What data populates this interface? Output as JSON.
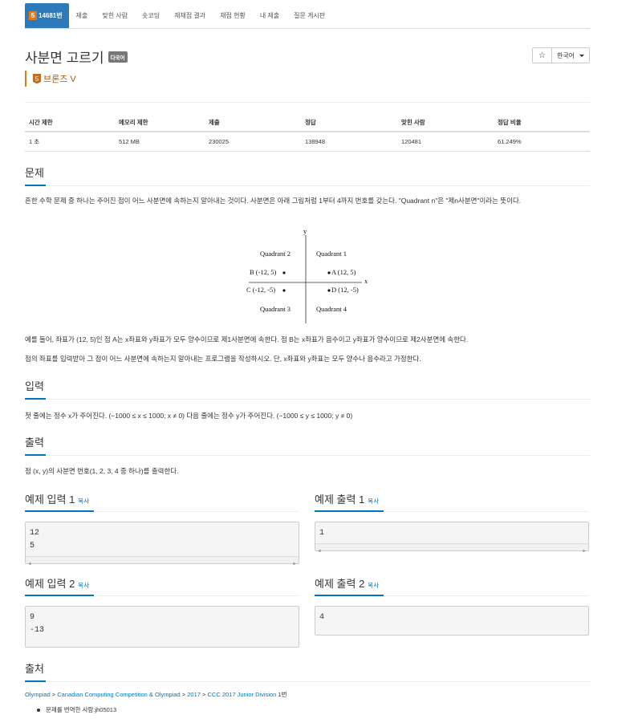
{
  "nav": {
    "problem_number": "14681번",
    "problem_badge": "5",
    "items": [
      "제출",
      "맞힌 사람",
      "숏코딩",
      "재채점 결과",
      "채점 현황",
      "내 제출",
      "질문 게시판"
    ]
  },
  "problem": {
    "title": "사분면 고르기",
    "lang_tag": "다국어",
    "tier_icon": "5",
    "tier": "브론즈 V"
  },
  "actions": {
    "star": "☆",
    "language": "한국어"
  },
  "stats": {
    "headers": [
      "시간 제한",
      "메모리 제한",
      "제출",
      "정답",
      "맞힌 사람",
      "정답 비율"
    ],
    "values": [
      "1 초",
      "512 MB",
      "230025",
      "138948",
      "120481",
      "61.249%"
    ]
  },
  "sections": {
    "problem_heading": "문제",
    "problem_text_1": "흔한 수학 문제 중 하나는 주어진 점이 어느 사분면에 속하는지 알아내는 것이다. 사분면은 아래 그림처럼 1부터 4까지 번호를 갖는다. \"Quadrant n\"은 \"제n사분면\"이라는 뜻이다.",
    "problem_text_2": "예를 들어, 좌표가 (12, 5)인 점 A는 x좌표와 y좌표가 모두 양수이므로 제1사분면에 속한다. 점 B는 x좌표가 음수이고 y좌표가 양수이므로 제2사분면에 속한다.",
    "problem_text_3": "점의 좌표를 입력받아 그 점이 어느 사분면에 속하는지 알아내는 프로그램을 작성하시오. 단, x좌표와 y좌표는 모두 양수나 음수라고 가정한다.",
    "input_heading": "입력",
    "input_text": "첫 줄에는 정수 x가 주어진다. (−1000 ≤ x ≤ 1000; x ≠ 0) 다음 줄에는 정수 y가 주어진다. (−1000 ≤ y ≤ 1000; y ≠ 0)",
    "output_heading": "출력",
    "output_text": "점 (x, y)의 사분면 번호(1, 2, 3, 4 중 하나)를 출력한다.",
    "source_heading": "출처"
  },
  "figure": {
    "y_label": "y",
    "x_label": "x",
    "q1": "Quadrant 1",
    "q2": "Quadrant 2",
    "q3": "Quadrant 3",
    "q4": "Quadrant 4",
    "a": "A (12, 5)",
    "b": "B (-12, 5)",
    "c": "C (-12, -5)",
    "d": "D (12, -5)"
  },
  "samples": {
    "copy_label": "복사",
    "in1_title": "예제 입력 1",
    "in1": "12\n5",
    "out1_title": "예제 출력 1",
    "out1": "1",
    "in2_title": "예제 입력 2",
    "in2": "9\n-13",
    "out2_title": "예제 출력 2",
    "out2": "4"
  },
  "source": {
    "olympiad": "Olympiad",
    "sep": " > ",
    "ccc": "Canadian Computing Competition & Olympiad",
    "year": "2017",
    "division": "CCC 2017 Junior Division",
    "number": " 1번",
    "translator_label": "문제를 번역한 사람: ",
    "translator": "jh05013"
  }
}
